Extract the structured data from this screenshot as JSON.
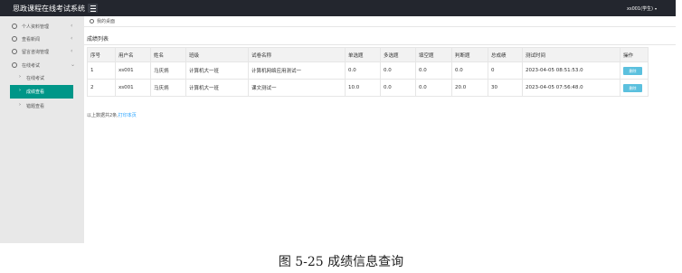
{
  "header": {
    "app_title": "思政课程在线考试系统",
    "user_label": "xs001(学生)",
    "user_caret": "▾",
    "menu_icon": "hamburger-icon"
  },
  "sidebar": {
    "items": [
      {
        "label": "个人资料管理",
        "arrow": "‹",
        "icon": "user-icon"
      },
      {
        "label": "查看新闻",
        "arrow": "‹",
        "icon": "user-icon"
      },
      {
        "label": "留言咨询管理",
        "arrow": "‹",
        "icon": "user-icon"
      },
      {
        "label": "在线考试",
        "arrow": "⌄",
        "icon": "user-icon"
      }
    ],
    "sub_items": [
      {
        "label": "在线考试",
        "arrow": "›"
      },
      {
        "label": "成绩查看",
        "arrow": "›",
        "active": true
      },
      {
        "label": "错题查看",
        "arrow": "›"
      }
    ]
  },
  "breadcrumb": {
    "text": "我的桌面",
    "icon": "home-icon"
  },
  "panel": {
    "title": "成绩列表"
  },
  "table": {
    "columns": [
      "序号",
      "用户名",
      "姓名",
      "班级",
      "试卷名称",
      "单选题",
      "多选题",
      "填空题",
      "判断题",
      "总成绩",
      "测试时间",
      "操作"
    ],
    "rows": [
      {
        "cells": [
          "1",
          "xs001",
          "马庆炳",
          "计算机大一班",
          "计算机网络应用测试一",
          "0.0",
          "0.0",
          "0.0",
          "0.0",
          "0",
          "2023-04-05 08:51:53.0"
        ],
        "action": "删除"
      },
      {
        "cells": [
          "2",
          "xs001",
          "马庆炳",
          "计算机大一班",
          "课文测试一",
          "10.0",
          "0.0",
          "0.0",
          "20.0",
          "30",
          "2023-04-05 07:56:48.0"
        ],
        "action": "删除"
      }
    ]
  },
  "summary": {
    "text": "以上数据共2条,",
    "print_link": "打印本页"
  },
  "caption": "图 5-25 成绩信息查询"
}
